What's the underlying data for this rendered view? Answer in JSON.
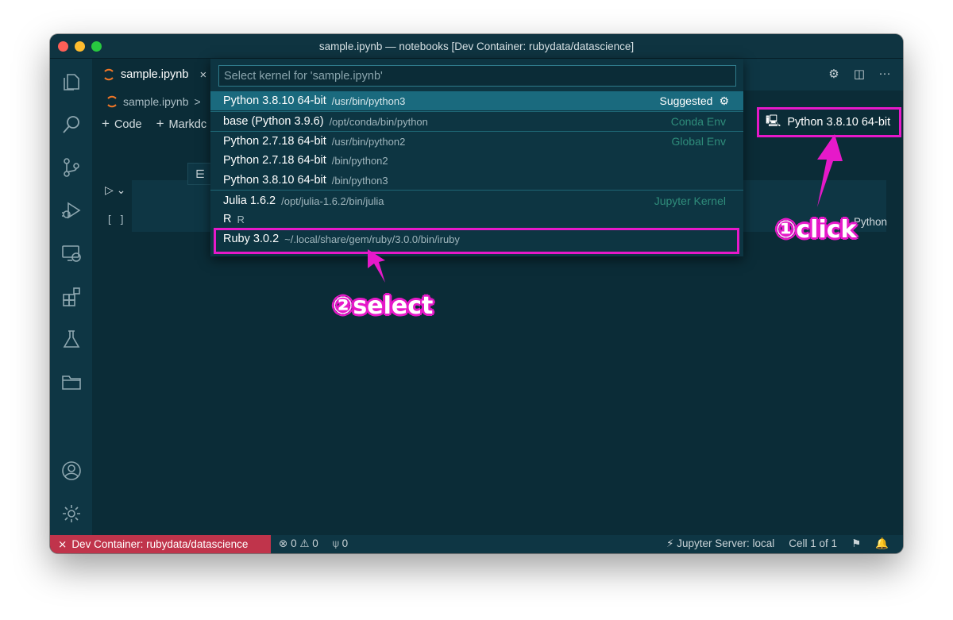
{
  "window": {
    "title": "sample.ipynb — notebooks [Dev Container: rubydata/datascience]"
  },
  "tab": {
    "label": "sample.ipynb",
    "close": "×"
  },
  "breadcrumb": {
    "file": "sample.ipynb",
    "sep": ">"
  },
  "notebook_toolbar": {
    "code": "Code",
    "markdown": "Markdc",
    "plus": "+"
  },
  "kernel_button": {
    "label": "Python 3.8.10 64-bit"
  },
  "cell": {
    "exec_count": "[ ]",
    "language": "Python"
  },
  "quick_pick": {
    "placeholder": "Select kernel for 'sample.ipynb'",
    "items": [
      {
        "name": "Python 3.8.10 64-bit",
        "path": "/usr/bin/python3",
        "tag": "Suggested"
      },
      {
        "name": "base (Python 3.9.6)",
        "path": "/opt/conda/bin/python",
        "tag": "Conda Env"
      },
      {
        "name": "Python 2.7.18 64-bit",
        "path": "/usr/bin/python2",
        "tag": "Global Env"
      },
      {
        "name": "Python 2.7.18 64-bit",
        "path": "/bin/python2",
        "tag": ""
      },
      {
        "name": "Python 3.8.10 64-bit",
        "path": "/bin/python3",
        "tag": ""
      },
      {
        "name": "Julia 1.6.2",
        "path": "/opt/julia-1.6.2/bin/julia",
        "tag": "Jupyter Kernel"
      },
      {
        "name": "R",
        "path": "R",
        "tag": ""
      },
      {
        "name": "Ruby 3.0.2",
        "path": "~/.local/share/gem/ruby/3.0.0/bin/iruby",
        "tag": ""
      }
    ]
  },
  "status_bar": {
    "remote": "Dev Container: rubydata/datascience",
    "errors": "0",
    "warnings": "0",
    "ports": "0",
    "jupyter": "Jupyter Server: local",
    "cell_pos": "Cell 1 of 1"
  },
  "annotations": {
    "click": "①click",
    "select": "②select"
  },
  "colors": {
    "accent": "#e619c9",
    "remote_bg": "#c0344b",
    "selected_row": "#1a6a7e",
    "window_bg": "#0b2c37"
  },
  "icons": [
    "explorer-icon",
    "search-icon",
    "source-control-icon",
    "run-debug-icon",
    "remote-explorer-icon",
    "extensions-icon",
    "testing-icon",
    "folder-icon",
    "account-icon",
    "settings-gear-icon"
  ]
}
